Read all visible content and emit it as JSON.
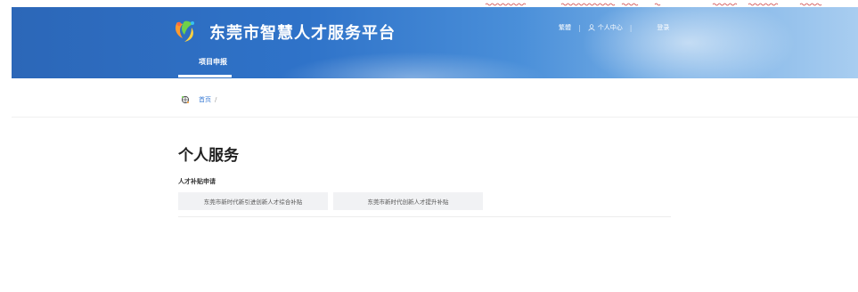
{
  "header": {
    "site_title": "东莞市智慧人才服务平台",
    "lang_toggle": "繁體",
    "user_center": "个人中心",
    "login": "登录",
    "nav_tabs": [
      {
        "label": "项目申报",
        "active": true
      }
    ]
  },
  "breadcrumb": {
    "home": "首页",
    "separator": "/"
  },
  "main": {
    "page_title": "个人服务",
    "section_title": "人才补贴申请",
    "services": [
      {
        "label": "东莞市新时代新引进创新人才综合补贴"
      },
      {
        "label": "东莞市新时代创新人才提升补贴"
      }
    ]
  },
  "colors": {
    "header_blue": "#2c67b8",
    "link_blue": "#3a7bd5",
    "button_bg": "#f1f2f4"
  }
}
